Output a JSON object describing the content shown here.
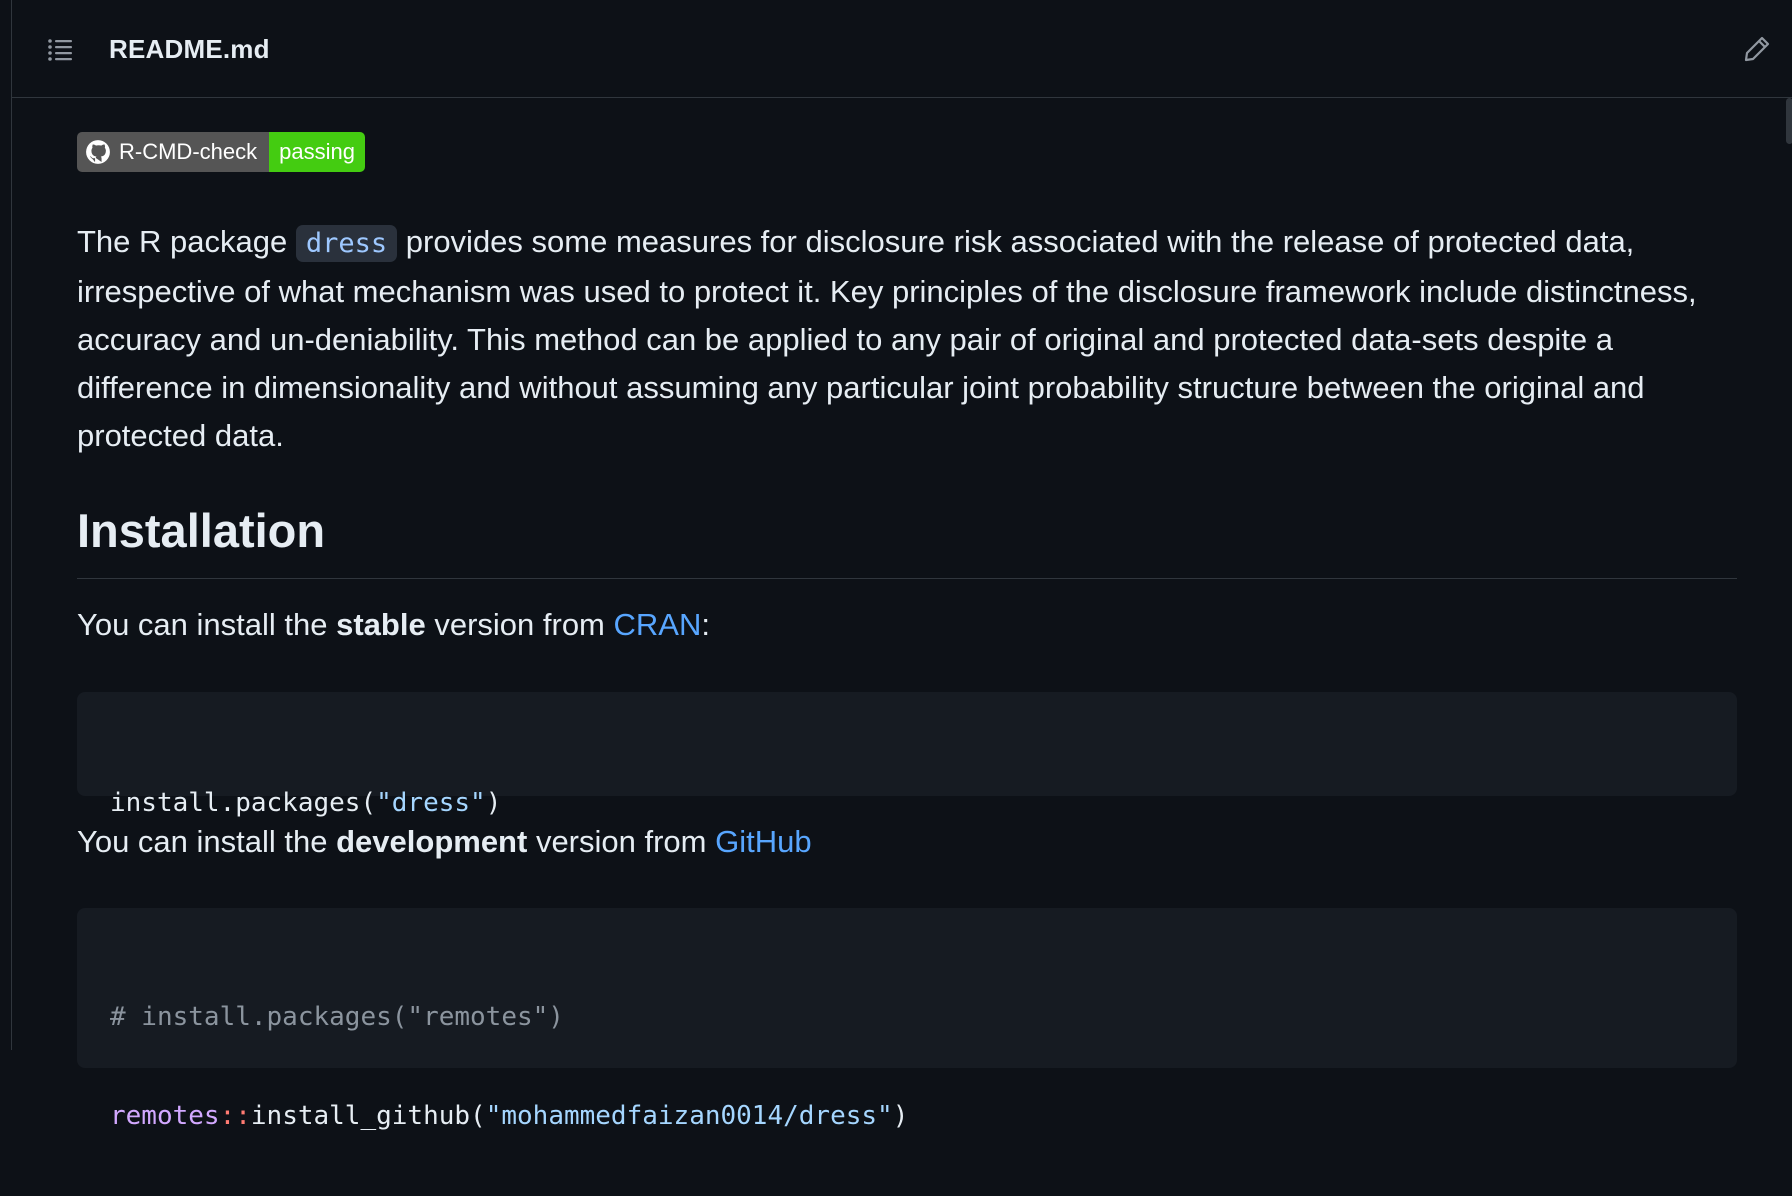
{
  "header": {
    "file_title": "README.md"
  },
  "badge": {
    "label": "R-CMD-check",
    "status": "passing",
    "status_color": "#44cc11"
  },
  "intro": {
    "text_before": "The R package ",
    "package_code": "dress",
    "text_after": " provides some measures for disclosure risk associated with the release of protected data, irrespective of what mechanism was used to protect it. Key principles of the disclosure framework include distinctness, accuracy and un-deniability. This method can be applied to any pair of original and protected data-sets despite a difference in dimensionality and without assuming any particular joint probability structure between the original and protected data."
  },
  "installation": {
    "heading": "Installation",
    "stable": {
      "prefix": "You can install the ",
      "bold": "stable",
      "middle": " version from ",
      "link": "CRAN",
      "suffix": ":"
    },
    "stable_code": {
      "fn": "install.packages(",
      "arg": "\"dress\"",
      "close": ")"
    },
    "dev": {
      "prefix": "You can install the ",
      "bold": "development",
      "middle": " version from ",
      "link": "GitHub"
    },
    "dev_code": {
      "comment": "# install.packages(\"remotes\")",
      "ns": "remotes",
      "op": "::",
      "fn": "install_github(",
      "arg": "\"mohammedfaizan0014/dress\"",
      "close": ")"
    }
  },
  "colors": {
    "background": "#0d1117",
    "link": "#58a6ff",
    "code_bg": "#161b22"
  },
  "icons": {
    "toc": "list-icon",
    "edit": "pencil-icon",
    "badge": "github-mark-icon"
  }
}
